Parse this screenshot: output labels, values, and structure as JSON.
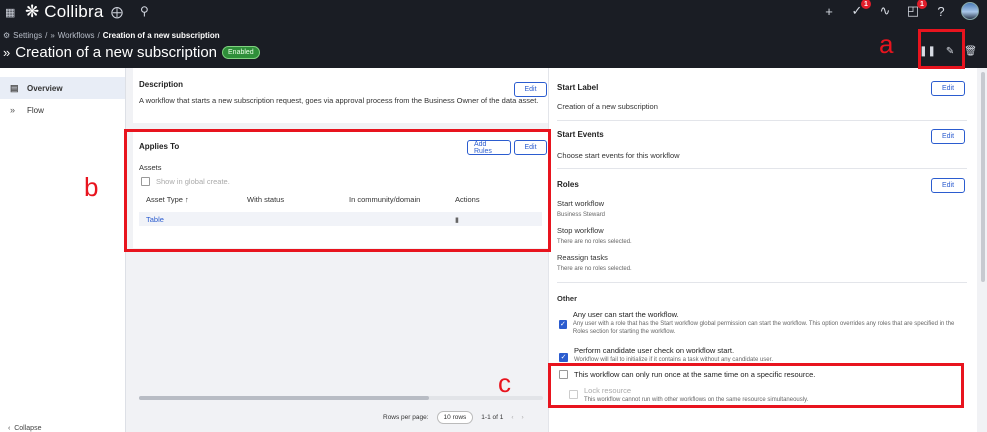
{
  "topbar": {
    "app_name": "Collibra",
    "badges": {
      "tasks": "1",
      "notifications": "1"
    }
  },
  "breadcrumb": {
    "settings": "Settings",
    "sep": "/",
    "workflows": "Workflows",
    "current": "Creation of a new subscription"
  },
  "title": {
    "text": "Creation of a new subscription",
    "status": "Enabled"
  },
  "annotations": {
    "a": "a",
    "b": "b",
    "c": "c"
  },
  "sidebar": {
    "items": [
      {
        "label": "Overview",
        "icon": "document-icon"
      },
      {
        "label": "Flow",
        "icon": "flow-icon"
      }
    ],
    "collapse_label": "Collapse"
  },
  "description": {
    "heading": "Description",
    "edit_label": "Edit",
    "text": "A workflow that starts a new subscription request, goes via approval process from the Business Owner of the data asset."
  },
  "applies_to": {
    "heading": "Applies To",
    "add_rules_label": "Add Rules",
    "edit_label": "Edit",
    "assets_label": "Assets",
    "global_create_label": "Show in global create.",
    "columns": [
      "Asset Type ↑",
      "With status",
      "In community/domain",
      "Actions"
    ],
    "rows": [
      {
        "asset_type": "Table",
        "status": "",
        "community": ""
      }
    ]
  },
  "pagination": {
    "rows_per_page_label": "Rows per page:",
    "rows_per_page_value": "10 rows",
    "range": "1-1 of 1"
  },
  "start_label": {
    "heading": "Start Label",
    "edit_label": "Edit",
    "value": "Creation of a new subscription"
  },
  "start_events": {
    "heading": "Start Events",
    "edit_label": "Edit",
    "value": "Choose start events for this workflow"
  },
  "roles": {
    "heading": "Roles",
    "edit_label": "Edit",
    "start_workflow_label": "Start workflow",
    "start_workflow_value": "Business Steward",
    "stop_workflow_label": "Stop workflow",
    "stop_workflow_value": "There are no roles selected.",
    "reassign_label": "Reassign tasks",
    "reassign_value": "There are no roles selected."
  },
  "other": {
    "heading": "Other",
    "options": [
      {
        "title": "Any user can start the workflow.",
        "desc": "Any user with a role that has the Start workflow global permission can start the workflow. This option overrides any roles that are specified in the Roles section for starting the workflow.",
        "checked": true
      },
      {
        "title": "Perform candidate user check on workflow start.",
        "desc": "Workflow will fail to initialize if it contains a task without any candidate user.",
        "checked": true
      },
      {
        "title": "This workflow can only run once at the same time on a specific resource.",
        "desc": "",
        "checked": false
      },
      {
        "title": "Lock resource",
        "desc": "This workflow cannot run with other workflows on the same resource simultaneously.",
        "checked": false
      }
    ]
  }
}
